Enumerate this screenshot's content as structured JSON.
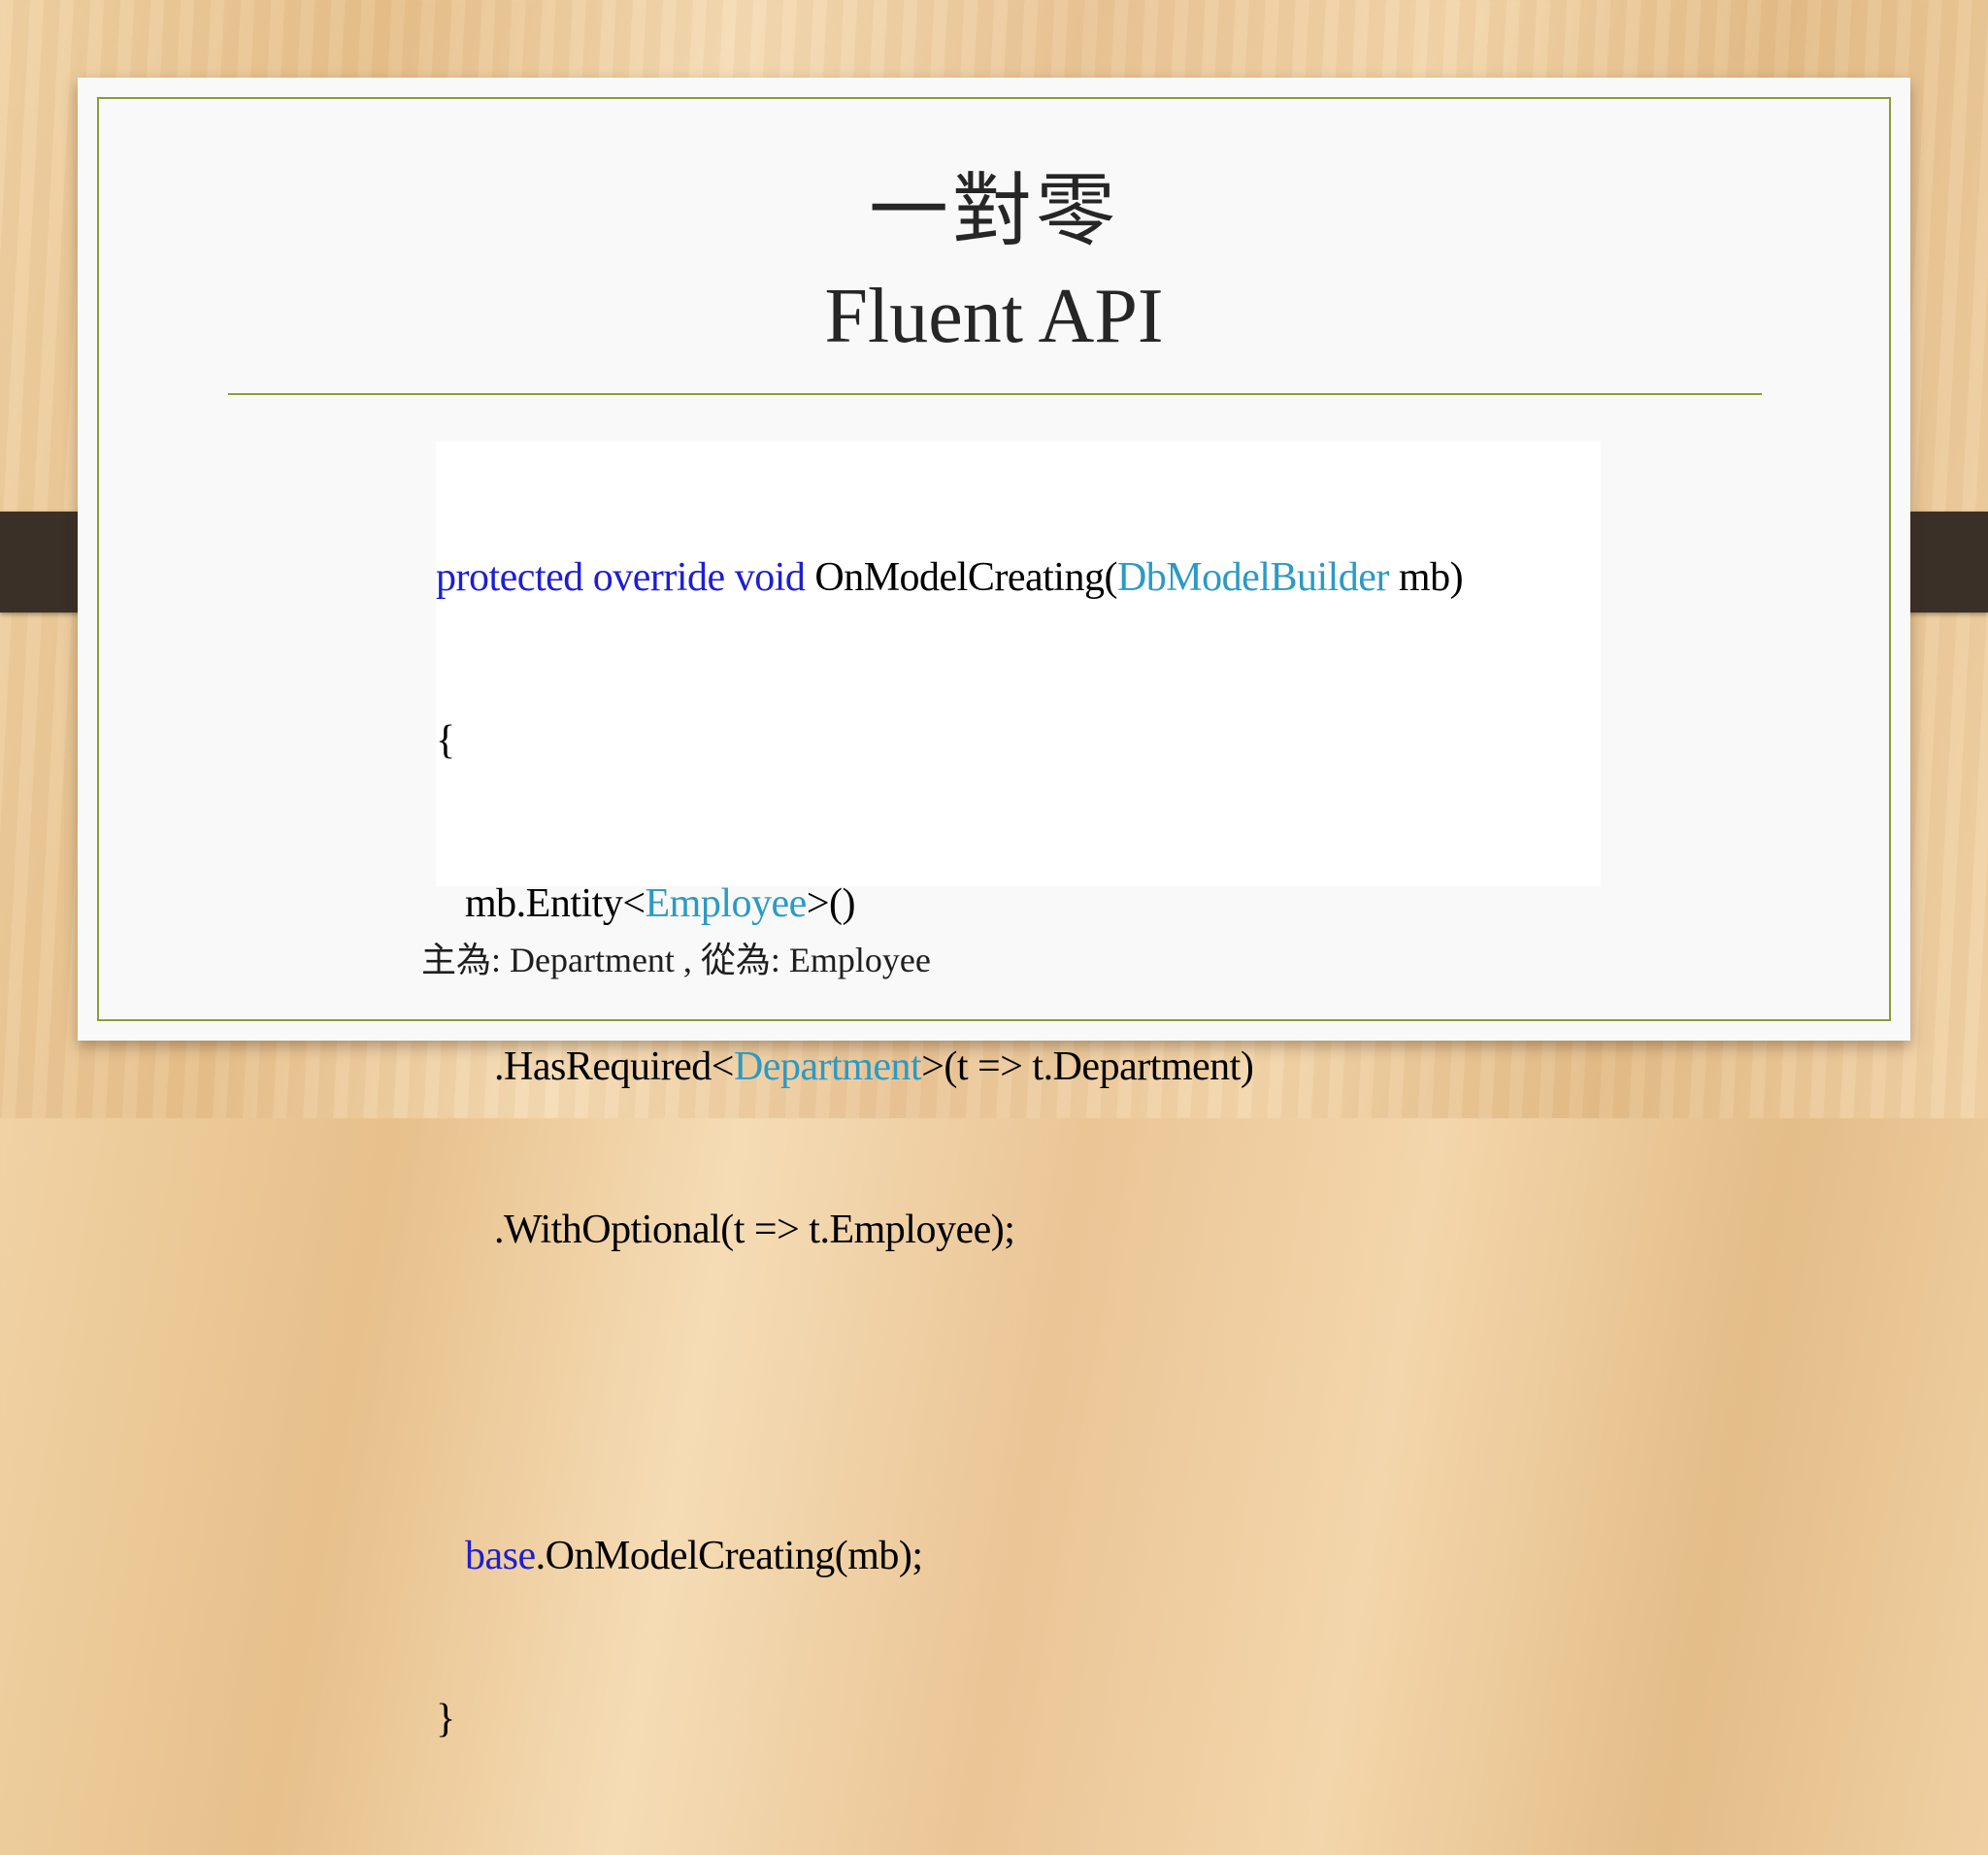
{
  "slide": {
    "title_cjk": "一對零",
    "title_latin": "Fluent API",
    "footnote": "主為: Department , 從為: Employee"
  },
  "code": {
    "line1": {
      "kw1": "protected",
      "kw2": "override",
      "kw3": "void",
      "method": "OnModelCreating(",
      "type": "DbModelBuilder",
      "rest": " mb)"
    },
    "line2": "{",
    "line3": {
      "pre": "mb.Entity<",
      "type": "Employee",
      "post": ">()"
    },
    "line4": {
      "pre": ".HasRequired<",
      "type": "Department",
      "post": ">(t => t.Department)"
    },
    "line5": ".WithOptional(t => t.Employee);",
    "line7": {
      "kw": "base",
      "post": ".OnModelCreating(mb);"
    },
    "line8": "}"
  },
  "colors": {
    "keyword": "#1e1ed2",
    "type": "#2b9ac4",
    "frame": "#8a9c3a"
  }
}
